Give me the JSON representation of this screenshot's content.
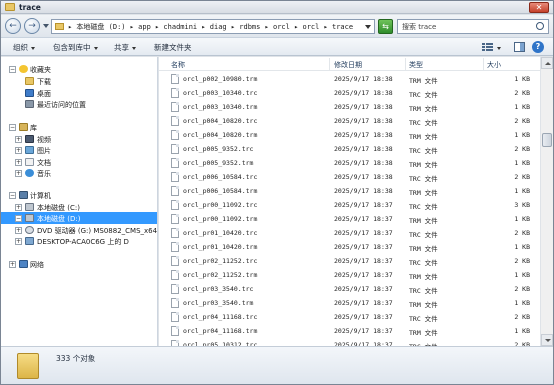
{
  "window": {
    "title": "trace",
    "close_glyph": "✕"
  },
  "nav": {
    "back_glyph": "←",
    "forward_glyph": "→",
    "refresh_glyph": "⇆"
  },
  "address": {
    "path": "▸ 本地磁盘 (D:) ▸ app ▸ chadmini ▸ diag ▸ rdbms ▸ orcl ▸ orcl ▸ trace"
  },
  "search": {
    "placeholder": "搜索 trace"
  },
  "toolbar": {
    "organize": "组织",
    "include_in_library": "包含到库中",
    "share": "共享",
    "new_folder": "新建文件夹",
    "help_glyph": "?"
  },
  "sidebar": {
    "favorites": {
      "label": "收藏夹",
      "items": [
        "下载",
        "桌面",
        "最近访问的位置"
      ]
    },
    "libraries": {
      "label": "库",
      "items": [
        "视频",
        "图片",
        "文档",
        "音乐"
      ]
    },
    "computer": {
      "label": "计算机",
      "items": [
        "本地磁盘 (C:)",
        "本地磁盘 (D:)",
        "DVD 驱动器 (G:) MS0882_CMS_x64_E",
        "DESKTOP-ACA0C6G 上的 D"
      ]
    },
    "network": {
      "label": "网络"
    },
    "expander_plus": "+",
    "expander_minus": "−"
  },
  "columns": {
    "name": "名称",
    "date": "修改日期",
    "type": "类型",
    "size": "大小"
  },
  "files": [
    {
      "name": "orcl_p002_10980.trm",
      "date": "2025/9/17 18:38",
      "type": "TRM 文件",
      "size": "1 KB"
    },
    {
      "name": "orcl_p003_10340.trc",
      "date": "2025/9/17 18:38",
      "type": "TRC 文件",
      "size": "2 KB"
    },
    {
      "name": "orcl_p003_10340.trm",
      "date": "2025/9/17 18:38",
      "type": "TRM 文件",
      "size": "1 KB"
    },
    {
      "name": "orcl_p004_10820.trc",
      "date": "2025/9/17 18:38",
      "type": "TRC 文件",
      "size": "2 KB"
    },
    {
      "name": "orcl_p004_10820.trm",
      "date": "2025/9/17 18:38",
      "type": "TRM 文件",
      "size": "1 KB"
    },
    {
      "name": "orcl_p005_9352.trc",
      "date": "2025/9/17 18:38",
      "type": "TRC 文件",
      "size": "2 KB"
    },
    {
      "name": "orcl_p005_9352.trm",
      "date": "2025/9/17 18:38",
      "type": "TRM 文件",
      "size": "1 KB"
    },
    {
      "name": "orcl_p006_10584.trc",
      "date": "2025/9/17 18:38",
      "type": "TRC 文件",
      "size": "2 KB"
    },
    {
      "name": "orcl_p006_10584.trm",
      "date": "2025/9/17 18:38",
      "type": "TRM 文件",
      "size": "1 KB"
    },
    {
      "name": "orcl_pr00_11092.trc",
      "date": "2025/9/17 18:37",
      "type": "TRC 文件",
      "size": "3 KB"
    },
    {
      "name": "orcl_pr00_11092.trm",
      "date": "2025/9/17 18:37",
      "type": "TRM 文件",
      "size": "1 KB"
    },
    {
      "name": "orcl_pr01_10420.trc",
      "date": "2025/9/17 18:37",
      "type": "TRC 文件",
      "size": "2 KB"
    },
    {
      "name": "orcl_pr01_10420.trm",
      "date": "2025/9/17 18:37",
      "type": "TRM 文件",
      "size": "1 KB"
    },
    {
      "name": "orcl_pr02_11252.trc",
      "date": "2025/9/17 18:37",
      "type": "TRC 文件",
      "size": "2 KB"
    },
    {
      "name": "orcl_pr02_11252.trm",
      "date": "2025/9/17 18:37",
      "type": "TRM 文件",
      "size": "1 KB"
    },
    {
      "name": "orcl_pr03_3540.trc",
      "date": "2025/9/17 18:37",
      "type": "TRC 文件",
      "size": "2 KB"
    },
    {
      "name": "orcl_pr03_3540.trm",
      "date": "2025/9/17 18:37",
      "type": "TRM 文件",
      "size": "1 KB"
    },
    {
      "name": "orcl_pr04_11168.trc",
      "date": "2025/9/17 18:37",
      "type": "TRC 文件",
      "size": "2 KB"
    },
    {
      "name": "orcl_pr04_11168.trm",
      "date": "2025/9/17 18:37",
      "type": "TRM 文件",
      "size": "1 KB"
    },
    {
      "name": "orcl_pr05_10312.trc",
      "date": "2025/9/17 18:37",
      "type": "TRC 文件",
      "size": "2 KB"
    }
  ],
  "status": {
    "count_text": "333 个对象"
  }
}
